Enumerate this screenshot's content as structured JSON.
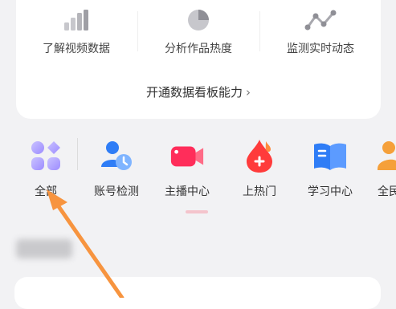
{
  "data_panel": {
    "features": [
      {
        "label": "了解视频数据",
        "icon": "bar-chart-icon"
      },
      {
        "label": "分析作品热度",
        "icon": "pie-chart-icon"
      },
      {
        "label": "监测实时动态",
        "icon": "line-trend-icon"
      }
    ],
    "open_link": "开通数据看板能力",
    "open_link_chevron": "›"
  },
  "tools": [
    {
      "label": "全部",
      "icon": "grid-four-icon"
    },
    {
      "label": "账号检测",
      "icon": "account-check-icon"
    },
    {
      "label": "主播中心",
      "icon": "video-camera-icon"
    },
    {
      "label": "上热门",
      "icon": "flame-drop-icon"
    },
    {
      "label": "学习中心",
      "icon": "open-book-icon"
    },
    {
      "label": "全民",
      "icon": "person-icon"
    }
  ],
  "colors": {
    "accent_red": "#ff2d5a",
    "accent_blue": "#2f7df6",
    "accent_orange": "#f5a03a",
    "annotation_arrow": "#f7943f"
  }
}
